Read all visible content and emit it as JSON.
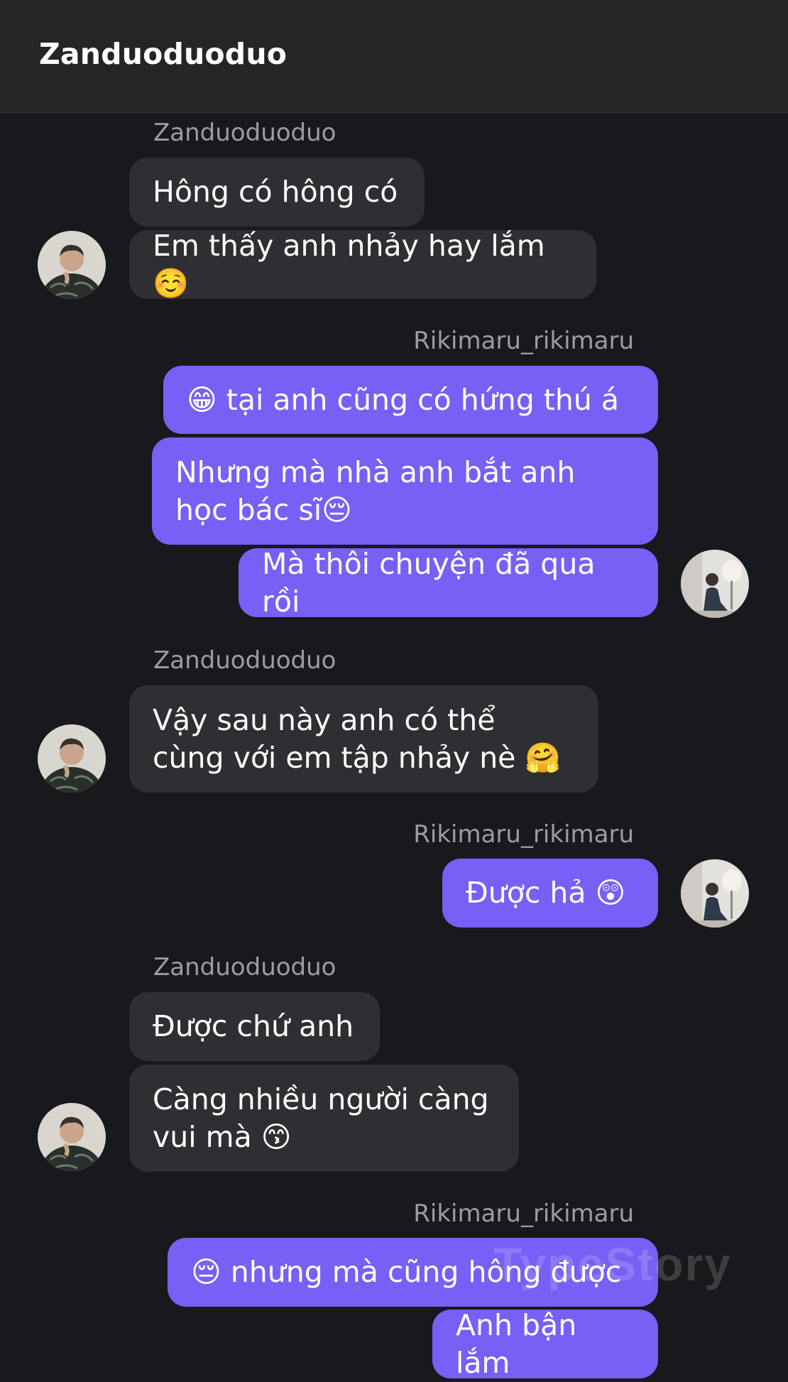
{
  "header": {
    "title": "Zanduoduoduo"
  },
  "participants": {
    "left": "Zanduoduoduo",
    "right": "Rikimaru_rikimaru"
  },
  "messages": [
    {
      "sender": "Zanduoduoduo",
      "bubbles": [
        "Hông có hông có",
        "Em thấy anh nhảy hay lắm☺️"
      ]
    },
    {
      "sender": "Rikimaru_rikimaru",
      "bubbles": [
        "😁 tại anh cũng có hứng thú á",
        "Nhưng mà nhà anh bắt anh học bác sĩ😔",
        "Mà thôi chuyện đã qua rồi"
      ]
    },
    {
      "sender": "Zanduoduoduo",
      "bubbles": [
        "Vậy sau này anh có thể cùng với em tập nhảy nè 🤗"
      ]
    },
    {
      "sender": "Rikimaru_rikimaru",
      "bubbles": [
        "Được hả 😲"
      ]
    },
    {
      "sender": "Zanduoduoduo",
      "bubbles": [
        "Được chứ anh",
        "Càng nhiều người càng vui mà 😙"
      ]
    },
    {
      "sender": "Rikimaru_rikimaru",
      "bubbles": [
        "😔 nhưng mà cũng hông được",
        "Anh bận lắm"
      ]
    }
  ],
  "watermark": "TypeStory",
  "colors": {
    "background": "#19181c",
    "header": "#252528",
    "incoming_bubble": "#2f2f33",
    "outgoing_bubble": "#7660f5",
    "sender_text": "#9d9ca3"
  }
}
